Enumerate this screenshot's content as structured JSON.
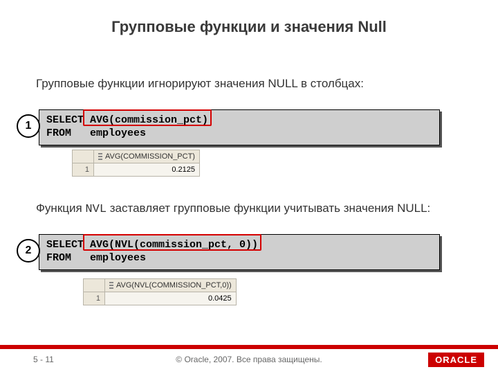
{
  "title": "Групповые функции и значения Null",
  "para1": "Групповые функции игнорируют значения NULL в столбцах:",
  "code1": {
    "line1a": "SELECT ",
    "line1b": "AVG(commission_pct)",
    "line2": "FROM   employees"
  },
  "badge1": "1",
  "result1": {
    "col": "AVG(COMMISSION_PCT)",
    "rownum": "1",
    "value": "0.2125"
  },
  "para2_pre": "Функция ",
  "para2_code": "NVL",
  "para2_post": " заставляет групповые функции учитывать значения NULL:",
  "code2": {
    "line1a": "SELECT ",
    "line1b": "AVG(NVL(commission_pct, 0))",
    "line2": "FROM   employees"
  },
  "badge2": "2",
  "result2": {
    "col": "AVG(NVL(COMMISSION_PCT,0))",
    "rownum": "1",
    "value": "0.0425"
  },
  "footer": {
    "page": "5 - 11",
    "copy": "© Oracle, 2007. Все права защищены.",
    "logo": "ORACLE"
  },
  "chart_data": {
    "type": "table",
    "title": "Групповые функции и значения Null",
    "series": [
      {
        "name": "AVG(COMMISSION_PCT)",
        "values": [
          0.2125
        ]
      },
      {
        "name": "AVG(NVL(COMMISSION_PCT,0))",
        "values": [
          0.0425
        ]
      }
    ]
  }
}
